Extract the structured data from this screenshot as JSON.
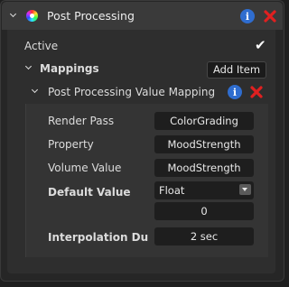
{
  "component": {
    "title": "Post Processing",
    "icon": "color-wheel-icon",
    "info_icon_glyph": "i"
  },
  "active": {
    "label": "Active",
    "checked_glyph": "✔"
  },
  "mappings": {
    "label": "Mappings",
    "add_item_label": "Add Item",
    "item": {
      "title": "Post Processing Value Mapping",
      "info_icon_glyph": "i",
      "rows": {
        "render_pass": {
          "label": "Render Pass",
          "value": "ColorGrading"
        },
        "property": {
          "label": "Property",
          "value": "MoodStrength"
        },
        "volume_value": {
          "label": "Volume Value",
          "value": "MoodStrength"
        },
        "default_value": {
          "label": "Default Value",
          "type": "Float",
          "value": "0"
        },
        "interpolation": {
          "label": "Interpolation Du",
          "value": "2 sec"
        }
      }
    }
  },
  "colors": {
    "accent_blue": "#2f6dcf",
    "delete_red": "#e02020"
  }
}
